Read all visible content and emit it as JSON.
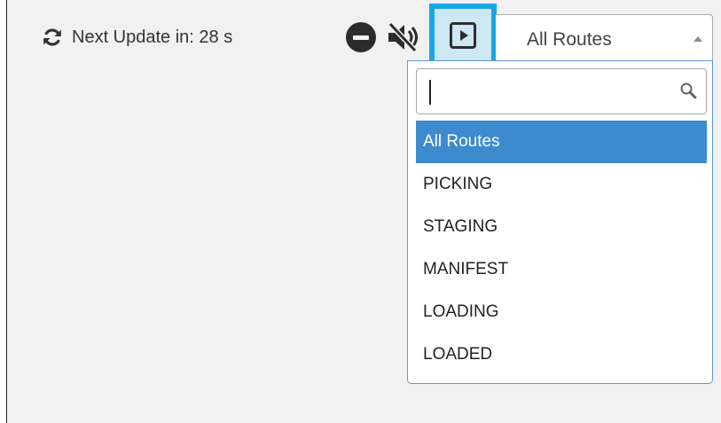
{
  "toolbar": {
    "next_update_text": "Next Update in: 28 s",
    "icons": {
      "refresh": "refresh-icon",
      "minus": "minus-circle-icon",
      "mute": "volume-mute-icon",
      "play": "play-square-icon"
    }
  },
  "route_select": {
    "selected_value": "All Routes",
    "search_value": "",
    "options": [
      {
        "label": "All Routes",
        "selected": true
      },
      {
        "label": "PICKING",
        "selected": false
      },
      {
        "label": "STAGING",
        "selected": false
      },
      {
        "label": "MANIFEST",
        "selected": false
      },
      {
        "label": "LOADING",
        "selected": false
      },
      {
        "label": "LOADED",
        "selected": false
      }
    ]
  },
  "colors": {
    "highlight_border": "#19a6e5",
    "highlight_fill": "#cde7f3",
    "option_selected": "#3e8ace",
    "dropdown_border": "#5b9bd5",
    "background": "#f1f1f1"
  }
}
